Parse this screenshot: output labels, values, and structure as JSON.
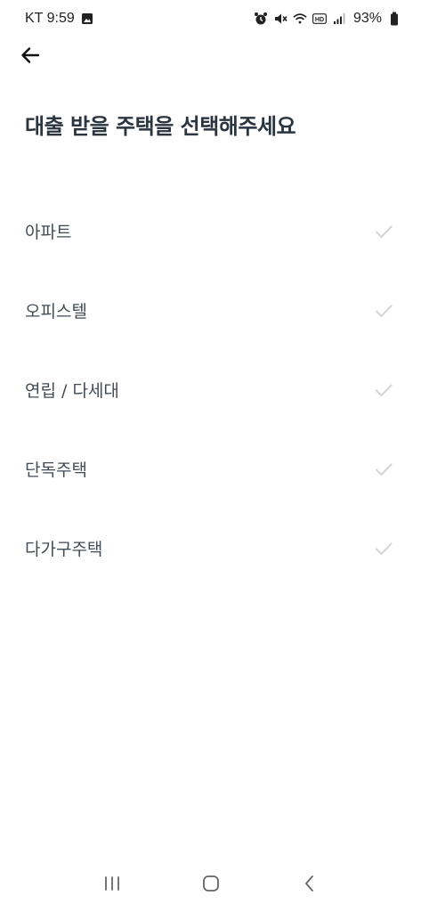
{
  "status_bar": {
    "carrier_time": "KT 9:59",
    "battery": "93%",
    "icons": [
      "gallery-icon",
      "alarm-icon",
      "mute-icon",
      "wifi-icon",
      "hd-icon",
      "signal-icon",
      "battery-icon"
    ]
  },
  "header": {
    "back_icon": "arrow-left-icon",
    "title": "대출 받을 주택을 선택해주세요"
  },
  "options": [
    {
      "label": "아파트"
    },
    {
      "label": "오피스텔"
    },
    {
      "label": "연립 / 다세대"
    },
    {
      "label": "단독주택"
    },
    {
      "label": "다가구주택"
    }
  ],
  "nav_bar": {
    "icons": [
      "recent-apps-icon",
      "home-icon",
      "back-icon"
    ]
  },
  "colors": {
    "title": "#2b3540",
    "option_text": "#434b54",
    "check_inactive": "#d3d7dc"
  }
}
